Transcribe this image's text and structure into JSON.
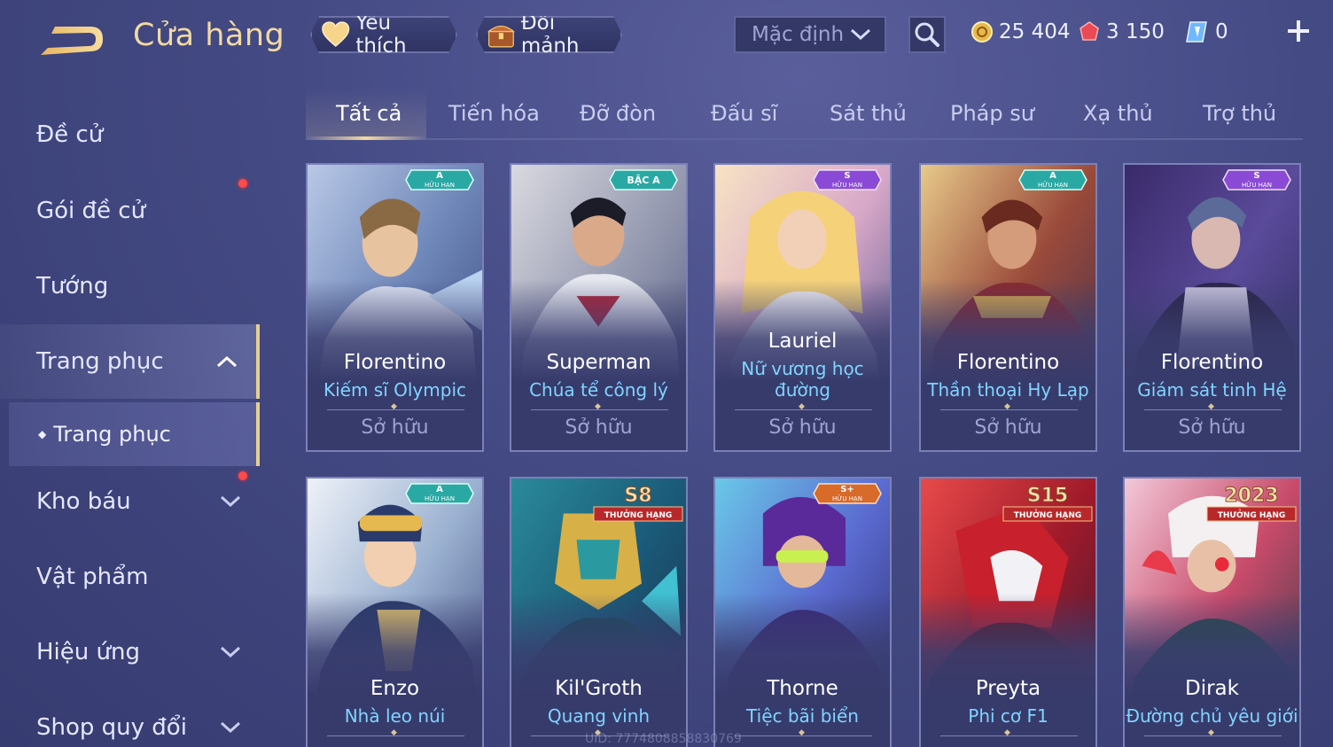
{
  "header": {
    "title": "Cửa hàng",
    "favorite_label": "Yêu thích",
    "shard_label": "Đổi mảnh",
    "sort_value": "Mặc định",
    "gold": "25 404",
    "ruby": "3 150",
    "voucher": "0"
  },
  "sidebar": {
    "items": [
      {
        "label": "Đề cử"
      },
      {
        "label": "Gói đề cử"
      },
      {
        "label": "Tướng"
      },
      {
        "label": "Trang phục"
      },
      {
        "label": "Kho báu"
      },
      {
        "label": "Vật phẩm"
      },
      {
        "label": "Hiệu ứng"
      },
      {
        "label": "Shop quy đổi"
      }
    ],
    "sub_item": "Trang phục"
  },
  "tabs": [
    "Tất cả",
    "Tiến hóa",
    "Đỡ đòn",
    "Đấu sĩ",
    "Sát thủ",
    "Pháp sư",
    "Xạ thủ",
    "Trợ thủ"
  ],
  "cards": [
    {
      "hero": "Florentino",
      "skin": "Kiếm sĩ Olympic",
      "status": "Sở hữu",
      "badge_top": "A",
      "badge_bottom": "HỮU HẠN"
    },
    {
      "hero": "Superman",
      "skin": "Chúa tể công lý",
      "status": "Sở hữu",
      "badge_top": "BẬC A",
      "badge_bottom": ""
    },
    {
      "hero": "Lauriel",
      "skin": "Nữ vương học",
      "skin2": "đường",
      "status": "Sở hữu",
      "badge_top": "S",
      "badge_bottom": "HỮU HẠN"
    },
    {
      "hero": "Florentino",
      "skin": "Thần thoại Hy Lạp",
      "status": "Sở hữu",
      "badge_top": "A",
      "badge_bottom": "HỮU HẠN"
    },
    {
      "hero": "Florentino",
      "skin": "Giám sát tinh Hệ",
      "status": "Sở hữu",
      "badge_top": "S",
      "badge_bottom": "HỮU HẠN"
    },
    {
      "hero": "Enzo",
      "skin": "Nhà leo núi",
      "badge_top": "A",
      "badge_bottom": "HỮU HẠN"
    },
    {
      "hero": "Kil'Groth",
      "skin": "Quang vinh",
      "badge_top": "S8",
      "badge_bottom": "THƯỞNG HẠNG"
    },
    {
      "hero": "Thorne",
      "skin": "Tiệc bãi biển",
      "badge_top": "S+",
      "badge_bottom": "HỮU HẠN"
    },
    {
      "hero": "Preyta",
      "skin": "Phi cơ F1",
      "badge_top": "S15",
      "badge_bottom": "THƯỞNG HẠNG"
    },
    {
      "hero": "Dirak",
      "skin": "Đường chủ yêu giới",
      "badge_top": "2023",
      "badge_bottom": "THƯỞNG HẠNG"
    }
  ],
  "uid_text": "UID: 7774808858830769",
  "colors": {
    "accent_gold": "#f2d9a0",
    "skin_name": "#7fd4ff",
    "notification": "#ff4a4a"
  }
}
